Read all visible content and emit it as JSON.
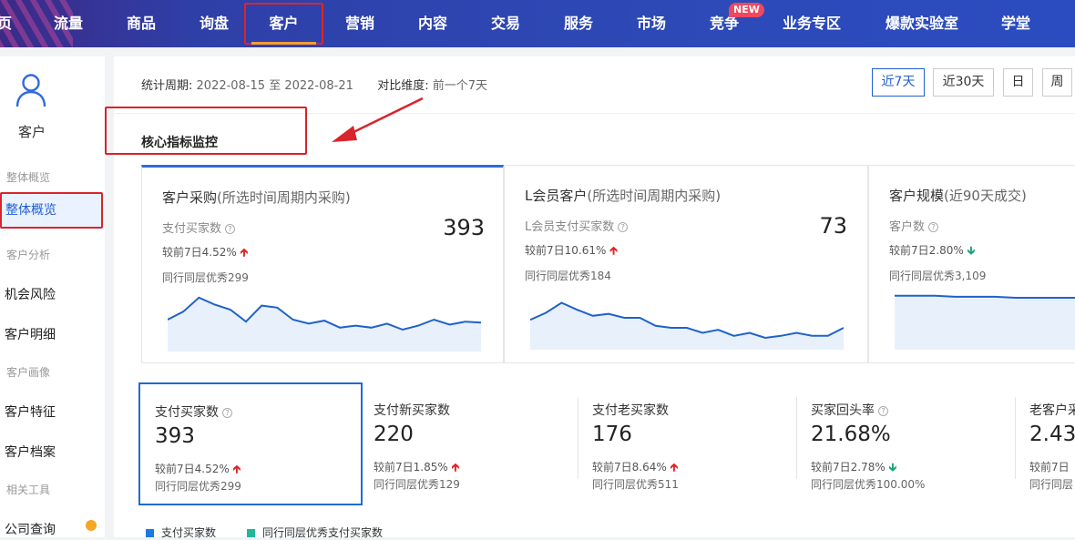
{
  "nav": {
    "items": [
      "页",
      "流量",
      "商品",
      "询盘",
      "客户",
      "营销",
      "内容",
      "交易",
      "服务",
      "市场",
      "竞争",
      "业务专区",
      "爆款实验室",
      "学堂"
    ],
    "active_index": 4,
    "new_badge": "NEW"
  },
  "sidebar": {
    "title": "客户",
    "sections": [
      "整体概览",
      "客户分析",
      "客户画像",
      "相关工具"
    ],
    "items": [
      "整体概览",
      "机会风险",
      "客户明细",
      "客户特征",
      "客户档案",
      "公司查询"
    ],
    "active_item": "整体概览"
  },
  "period": {
    "label": "统计周期:",
    "value": "2022-08-15 至 2022-08-21",
    "compare_label": "对比维度:",
    "compare_value": "前一个7天",
    "buttons": [
      "近7天",
      "近30天",
      "日",
      "周"
    ],
    "active_button": "近7天"
  },
  "section_title": "核心指标监控",
  "cards": [
    {
      "title": "客户采购",
      "subtitle": "(所选时间周期内采购)",
      "metric_label": "支付买家数",
      "value": "393",
      "compare": "较前7日4.52%",
      "trend": "up",
      "peer": "同行同层优秀299",
      "spark": [
        30,
        38,
        52,
        45,
        40,
        28,
        44,
        42,
        30,
        26,
        29,
        22,
        24,
        22,
        26,
        20,
        24,
        30,
        25,
        28,
        27
      ]
    },
    {
      "title": "L会员客户",
      "subtitle": "(所选时间周期内采购)",
      "metric_label": "L会员支付买家数",
      "value": "73",
      "compare": "较前7日10.61%",
      "trend": "up",
      "peer": "同行同层优秀184",
      "spark": [
        28,
        35,
        45,
        38,
        32,
        34,
        30,
        30,
        22,
        20,
        20,
        15,
        18,
        12,
        15,
        10,
        12,
        15,
        12,
        12,
        20
      ]
    },
    {
      "title": "客户规模",
      "subtitle": "(近90天成交)",
      "metric_label": "客户数",
      "value": "",
      "compare": "较前7日2.80%",
      "trend": "down",
      "peer": "同行同层优秀3,109",
      "spark": [
        52,
        52,
        52,
        51,
        51,
        51,
        50,
        50,
        50,
        50
      ]
    }
  ],
  "kpis": [
    {
      "label": "支付买家数",
      "has_help": true,
      "value": "393",
      "compare": "较前7日4.52%",
      "trend": "up",
      "peer": "同行同层优秀299"
    },
    {
      "label": "支付新买家数",
      "has_help": false,
      "value": "220",
      "compare": "较前7日1.85%",
      "trend": "up",
      "peer": "同行同层优秀129"
    },
    {
      "label": "支付老买家数",
      "has_help": false,
      "value": "176",
      "compare": "较前7日8.64%",
      "trend": "up",
      "peer": "同行同层优秀511"
    },
    {
      "label": "买家回头率",
      "has_help": true,
      "value": "21.68%",
      "compare": "较前7日2.78%",
      "trend": "down",
      "peer": "同行同层优秀100.00%"
    },
    {
      "label": "老客户采",
      "has_help": false,
      "value": "2.43%",
      "compare": "较前7日",
      "trend": "",
      "peer": "同行同层"
    }
  ],
  "legend": [
    {
      "label": "支付买家数",
      "color": "#1f78e0"
    },
    {
      "label": "同行同层优秀支付买家数",
      "color": "#1fb89a"
    }
  ],
  "colors": {
    "accent": "#2f6be0",
    "annotation_red": "#d9232d",
    "up": "#e02424",
    "down": "#17a673"
  }
}
